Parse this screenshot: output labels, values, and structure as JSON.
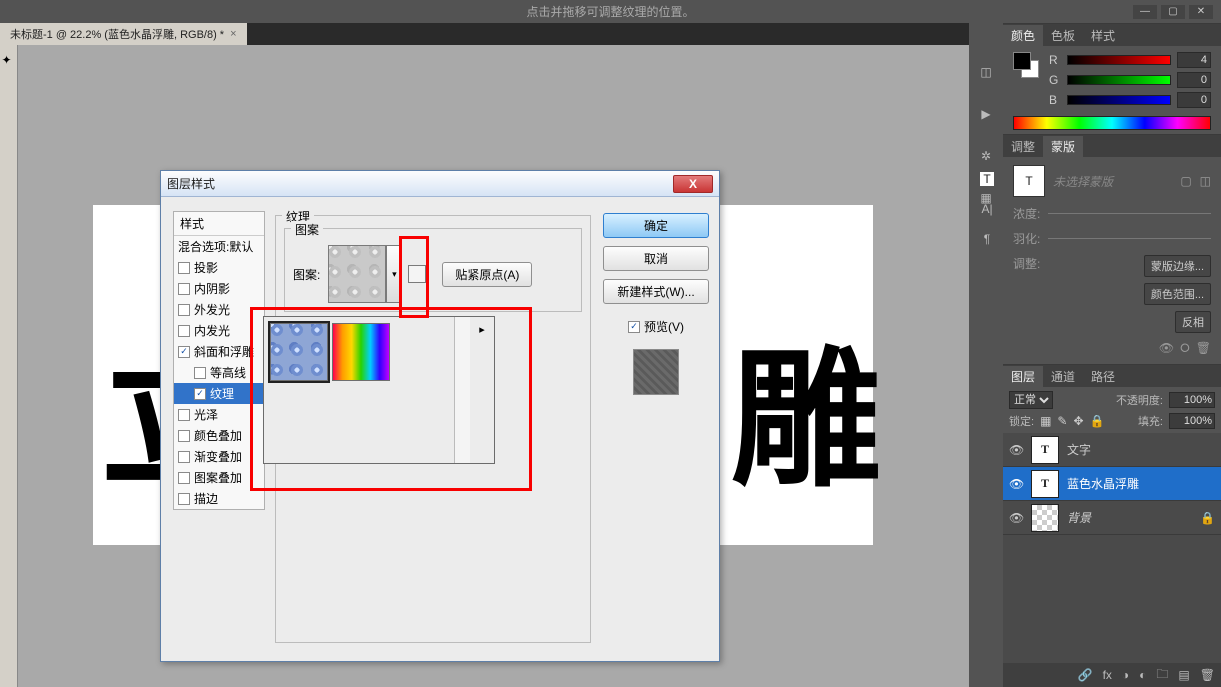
{
  "menubar": {
    "hint_text": "点击并拖移可调整纹理的位置。"
  },
  "doc_tab": {
    "title": "未标题-1 @ 22.2% (蓝色水晶浮雕, RGB/8) *",
    "close": "×"
  },
  "canvas": {
    "left_frag": "立",
    "right_frag": "雕"
  },
  "dialog": {
    "title": "图层样式",
    "styles_header": "样式",
    "styles": {
      "blending": "混合选项:默认",
      "items": [
        {
          "label": "投影",
          "checked": false
        },
        {
          "label": "内阴影",
          "checked": false
        },
        {
          "label": "外发光",
          "checked": false
        },
        {
          "label": "内发光",
          "checked": false
        },
        {
          "label": "斜面和浮雕",
          "checked": true,
          "selected": false
        },
        {
          "label": "等高线",
          "checked": false,
          "indent": true
        },
        {
          "label": "纹理",
          "checked": true,
          "indent": true,
          "selected": true
        },
        {
          "label": "光泽",
          "checked": false
        },
        {
          "label": "颜色叠加",
          "checked": false
        },
        {
          "label": "渐变叠加",
          "checked": false
        },
        {
          "label": "图案叠加",
          "checked": false
        },
        {
          "label": "描边",
          "checked": false
        }
      ]
    },
    "settings": {
      "section_label": "纹理",
      "group_label": "图案",
      "pattern_label": "图案:",
      "snap_button": "贴紧原点(A)"
    },
    "buttons": {
      "ok": "确定",
      "cancel": "取消",
      "new_style": "新建样式(W)...",
      "preview": "预览(V)"
    }
  },
  "right": {
    "color_panel": {
      "tabs": [
        "颜色",
        "色板",
        "样式"
      ],
      "r": {
        "label": "R",
        "value": "4"
      },
      "g": {
        "label": "G",
        "value": "0"
      },
      "b": {
        "label": "B",
        "value": "0"
      }
    },
    "mask_panel": {
      "tabs": [
        "调整",
        "蒙版"
      ],
      "placeholder": "未选择蒙版",
      "density_label": "浓度:",
      "feather_label": "羽化:",
      "adjust_label": "调整:",
      "btn_edge": "蒙版边缘...",
      "btn_range": "颜色范围...",
      "btn_invert": "反相"
    },
    "layers_panel": {
      "tabs": [
        "图层",
        "通道",
        "路径"
      ],
      "blend_mode": "正常",
      "opacity_label": "不透明度:",
      "opacity_value": "100%",
      "lock_label": "锁定:",
      "fill_label": "填充:",
      "fill_value": "100%",
      "layers": [
        {
          "name": "文字",
          "type": "T",
          "visible": true
        },
        {
          "name": "蓝色水晶浮雕",
          "type": "T",
          "visible": true,
          "selected": true
        },
        {
          "name": "背景",
          "type": "bg",
          "visible": true,
          "locked": true
        }
      ]
    }
  }
}
